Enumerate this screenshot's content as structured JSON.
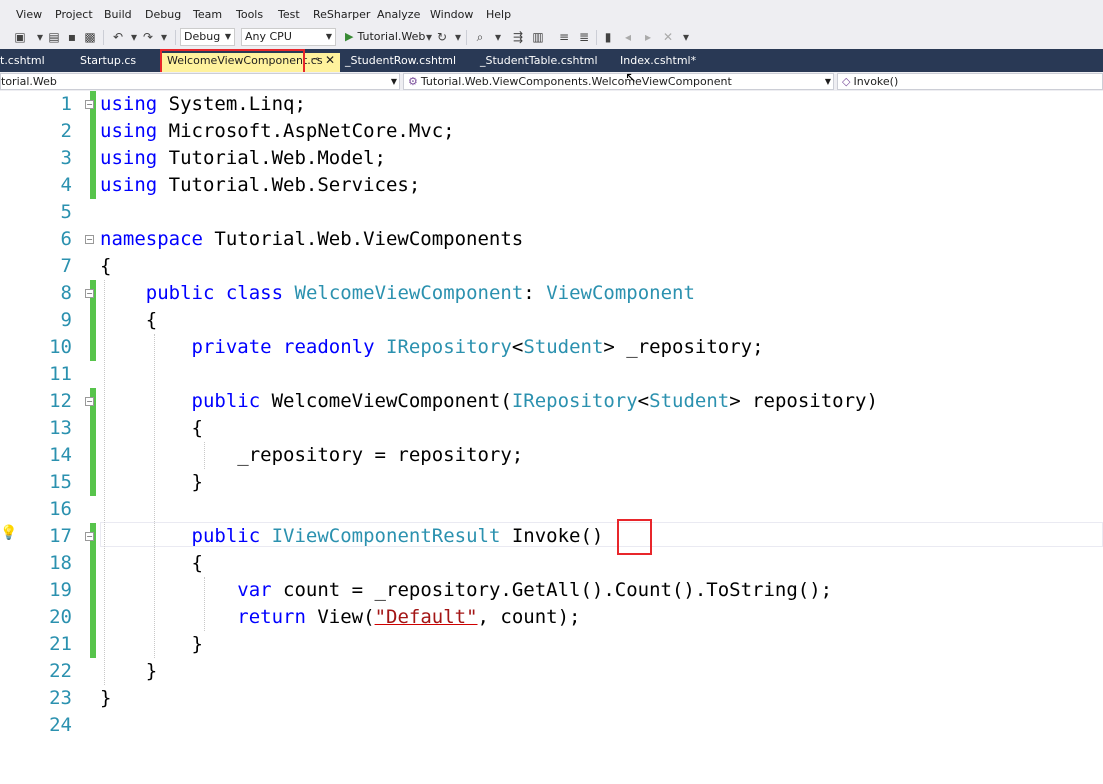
{
  "menu": [
    "View",
    "Project",
    "Build",
    "Debug",
    "Team",
    "Tools",
    "Test",
    "ReSharper",
    "Analyze",
    "Window",
    "Help"
  ],
  "toolbar": {
    "config": "Debug",
    "platform": "Any CPU",
    "run_label": "Tutorial.Web"
  },
  "tabs": [
    {
      "label": "t.cshtml"
    },
    {
      "label": "Startup.cs"
    },
    {
      "label": "WelcomeViewComponent.cs"
    },
    {
      "label": "_StudentRow.cshtml"
    },
    {
      "label": "_StudentTable.cshtml"
    },
    {
      "label": "Index.cshtml*"
    }
  ],
  "navbar": {
    "project": "torial.Web",
    "type": "Tutorial.Web.ViewComponents.WelcomeViewComponent",
    "member": "Invoke()"
  },
  "colors": {
    "accent": "#e8262b",
    "changed": "#57c44b",
    "tab_active": "#fff29d",
    "tab_strip": "#293955"
  },
  "code": [
    {
      "n": "1",
      "tokens": [
        {
          "c": "k",
          "t": "using"
        },
        {
          "c": "",
          "t": " System.Linq;"
        }
      ]
    },
    {
      "n": "2",
      "tokens": [
        {
          "c": "k",
          "t": "using"
        },
        {
          "c": "",
          "t": " Microsoft.AspNetCore.Mvc;"
        }
      ]
    },
    {
      "n": "3",
      "tokens": [
        {
          "c": "k",
          "t": "using"
        },
        {
          "c": "",
          "t": " Tutorial.Web.Model;"
        }
      ]
    },
    {
      "n": "4",
      "tokens": [
        {
          "c": "k",
          "t": "using"
        },
        {
          "c": "",
          "t": " Tutorial.Web.Services;"
        }
      ]
    },
    {
      "n": "5",
      "tokens": []
    },
    {
      "n": "6",
      "tokens": [
        {
          "c": "k",
          "t": "namespace"
        },
        {
          "c": "",
          "t": " Tutorial.Web.ViewComponents"
        }
      ]
    },
    {
      "n": "7",
      "tokens": [
        {
          "c": "",
          "t": "{"
        }
      ]
    },
    {
      "n": "8",
      "tokens": [
        {
          "c": "",
          "t": "    "
        },
        {
          "c": "k",
          "t": "public"
        },
        {
          "c": "",
          "t": " "
        },
        {
          "c": "k",
          "t": "class"
        },
        {
          "c": "",
          "t": " "
        },
        {
          "c": "t",
          "t": "WelcomeViewComponent"
        },
        {
          "c": "",
          "t": ": "
        },
        {
          "c": "t",
          "t": "ViewComponent"
        }
      ]
    },
    {
      "n": "9",
      "tokens": [
        {
          "c": "",
          "t": "    {"
        }
      ]
    },
    {
      "n": "10",
      "tokens": [
        {
          "c": "",
          "t": "        "
        },
        {
          "c": "k",
          "t": "private"
        },
        {
          "c": "",
          "t": " "
        },
        {
          "c": "k",
          "t": "readonly"
        },
        {
          "c": "",
          "t": " "
        },
        {
          "c": "t",
          "t": "IRepository"
        },
        {
          "c": "",
          "t": "<"
        },
        {
          "c": "t",
          "t": "Student"
        },
        {
          "c": "",
          "t": "> _repository;"
        }
      ]
    },
    {
      "n": "11",
      "tokens": []
    },
    {
      "n": "12",
      "tokens": [
        {
          "c": "",
          "t": "        "
        },
        {
          "c": "k",
          "t": "public"
        },
        {
          "c": "",
          "t": " WelcomeViewComponent("
        },
        {
          "c": "t",
          "t": "IRepository"
        },
        {
          "c": "",
          "t": "<"
        },
        {
          "c": "t",
          "t": "Student"
        },
        {
          "c": "",
          "t": "> repository)"
        }
      ]
    },
    {
      "n": "13",
      "tokens": [
        {
          "c": "",
          "t": "        {"
        }
      ]
    },
    {
      "n": "14",
      "tokens": [
        {
          "c": "",
          "t": "            _repository = repository;"
        }
      ]
    },
    {
      "n": "15",
      "tokens": [
        {
          "c": "",
          "t": "        }"
        }
      ]
    },
    {
      "n": "16",
      "tokens": []
    },
    {
      "n": "17",
      "tokens": [
        {
          "c": "",
          "t": "        "
        },
        {
          "c": "k",
          "t": "public"
        },
        {
          "c": "",
          "t": " "
        },
        {
          "c": "t",
          "t": "IViewComponentResult"
        },
        {
          "c": "",
          "t": " Invoke()"
        }
      ]
    },
    {
      "n": "18",
      "tokens": [
        {
          "c": "",
          "t": "        {"
        }
      ]
    },
    {
      "n": "19",
      "tokens": [
        {
          "c": "",
          "t": "            "
        },
        {
          "c": "k",
          "t": "var"
        },
        {
          "c": "",
          "t": " count = _repository.GetAll().Count().ToString();"
        }
      ]
    },
    {
      "n": "20",
      "tokens": [
        {
          "c": "",
          "t": "            "
        },
        {
          "c": "k",
          "t": "return"
        },
        {
          "c": "",
          "t": " View("
        },
        {
          "c": "s",
          "t": "\"Default\""
        },
        {
          "c": "",
          "t": ", count);"
        }
      ]
    },
    {
      "n": "21",
      "tokens": [
        {
          "c": "",
          "t": "        }"
        }
      ]
    },
    {
      "n": "22",
      "tokens": [
        {
          "c": "",
          "t": "    }"
        }
      ]
    },
    {
      "n": "23",
      "tokens": [
        {
          "c": "",
          "t": "}"
        }
      ]
    },
    {
      "n": "24",
      "tokens": []
    }
  ]
}
